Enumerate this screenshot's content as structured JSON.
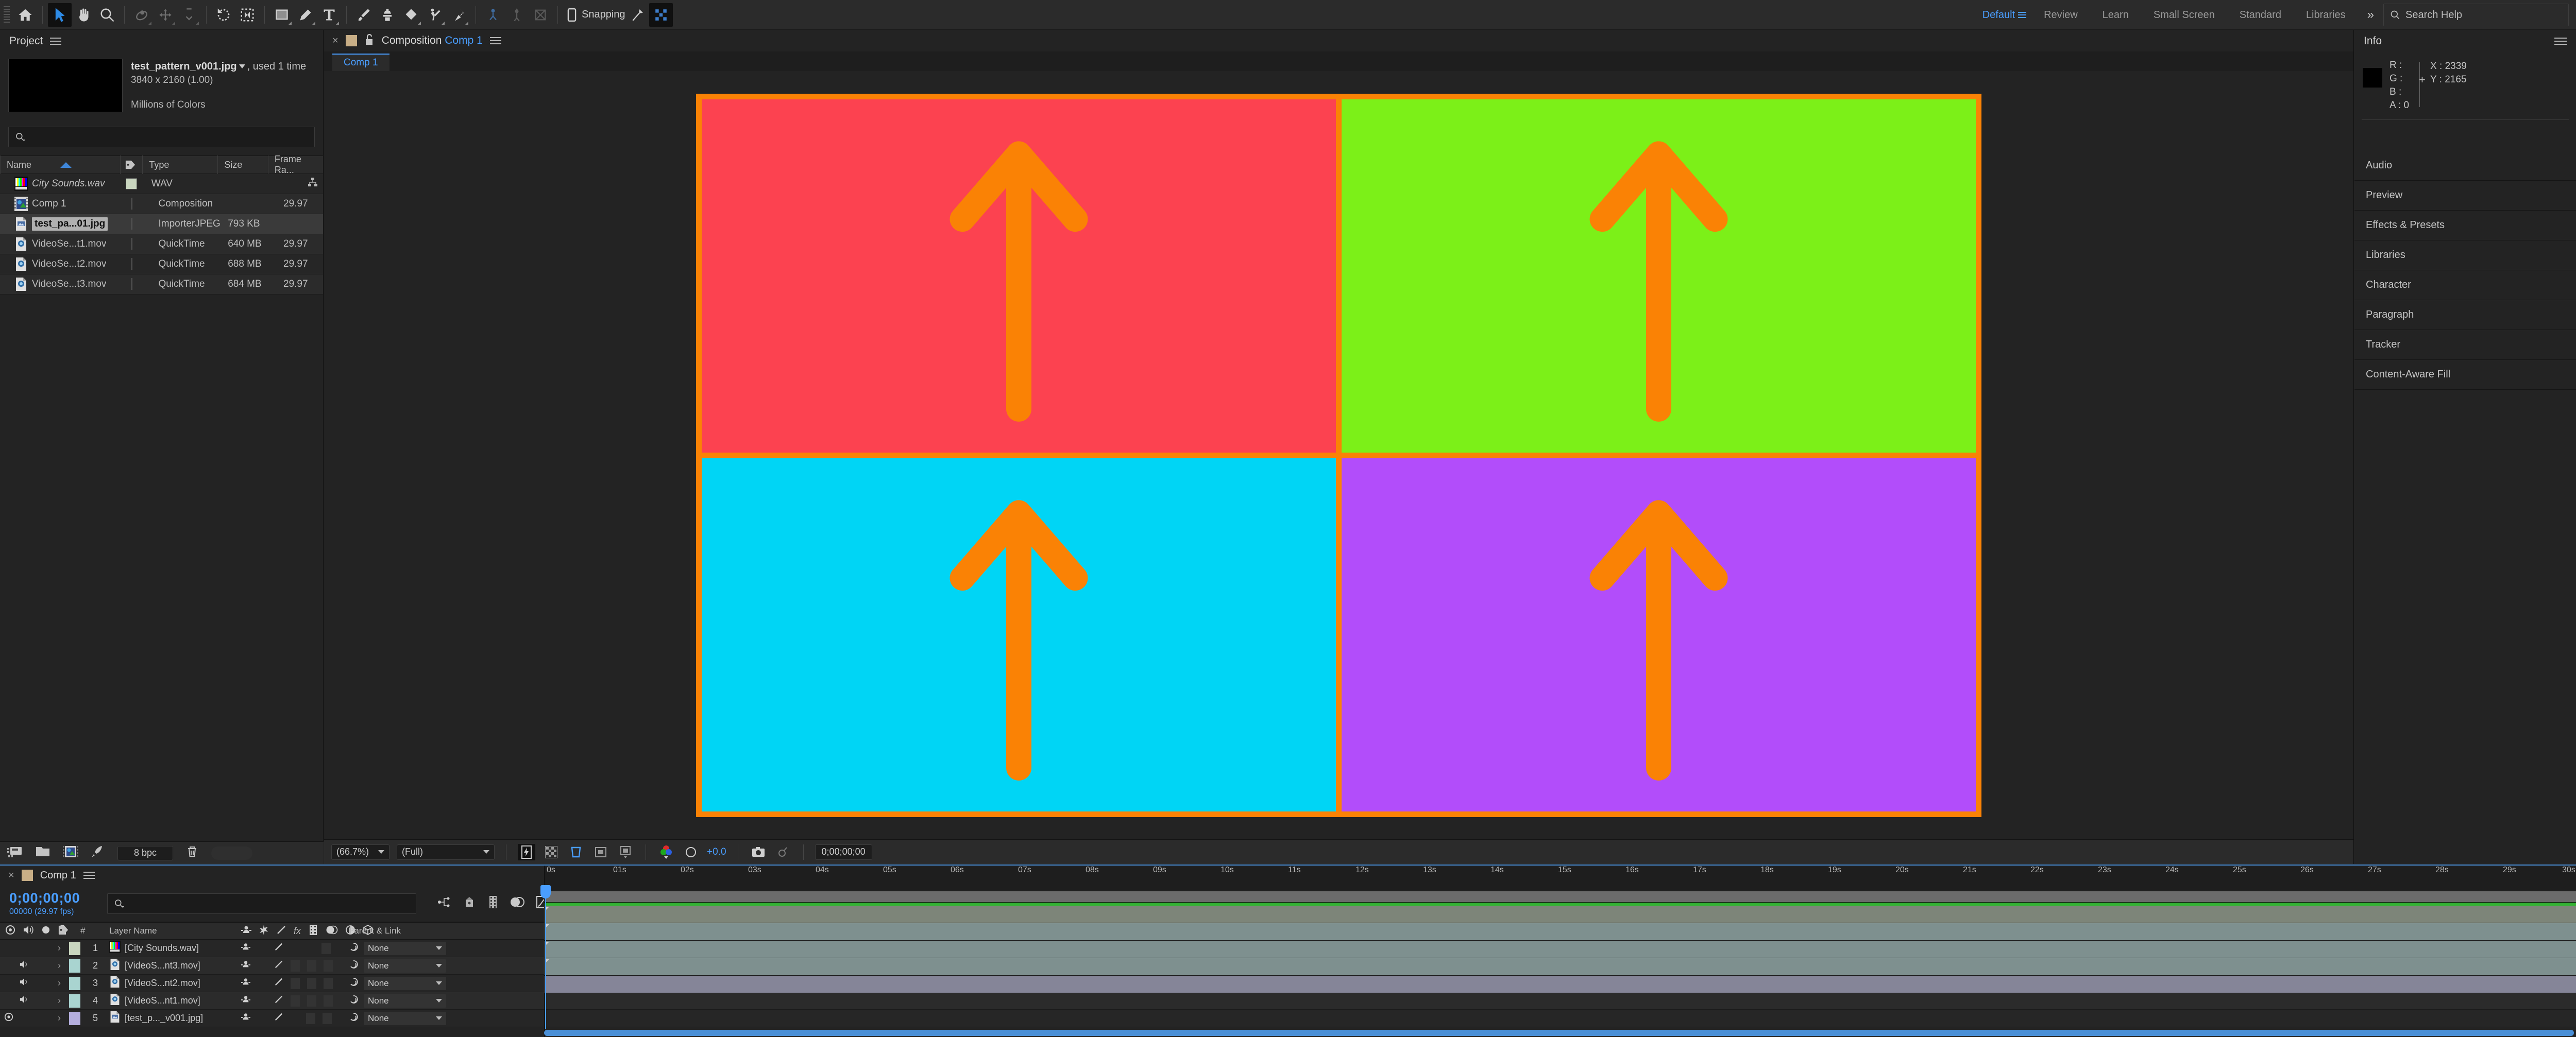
{
  "app": {
    "name": "Adobe After Effects"
  },
  "toolbar": {
    "tools": [
      {
        "name": "home-icon",
        "label": "Home"
      },
      {
        "name": "selection-tool-icon",
        "label": "Selection Tool"
      },
      {
        "name": "hand-tool-icon",
        "label": "Hand Tool"
      },
      {
        "name": "zoom-tool-icon",
        "label": "Zoom Tool"
      },
      {
        "name": "orbit-tool-icon",
        "label": "Orbit Around Cursor Tool"
      },
      {
        "name": "pan-tool-icon",
        "label": "Pan Under Cursor Tool"
      },
      {
        "name": "dolly-tool-icon",
        "label": "Dolly Towards Cursor Tool"
      },
      {
        "name": "rotation-tool-icon",
        "label": "Rotation Tool"
      },
      {
        "name": "anchor-point-tool-icon",
        "label": "Pan Behind (Anchor Point) Tool"
      },
      {
        "name": "rectangle-tool-icon",
        "label": "Rectangle Tool"
      },
      {
        "name": "pen-tool-icon",
        "label": "Pen Tool"
      },
      {
        "name": "type-tool-icon",
        "label": "Horizontal Type Tool"
      },
      {
        "name": "brush-tool-icon",
        "label": "Brush Tool"
      },
      {
        "name": "clone-stamp-tool-icon",
        "label": "Clone Stamp Tool"
      },
      {
        "name": "eraser-tool-icon",
        "label": "Eraser Tool"
      },
      {
        "name": "roto-brush-tool-icon",
        "label": "Roto Brush Tool"
      },
      {
        "name": "puppet-pin-tool-icon",
        "label": "Puppet Position Pin Tool"
      },
      {
        "name": "rigging-tool-icon",
        "label": "Rigging"
      },
      {
        "name": "puppet-starch-tool-icon",
        "label": "Puppet Starch Pin Tool"
      },
      {
        "name": "mesh-tool-icon",
        "label": "Puppet Mesh"
      }
    ],
    "snapping_label": "Snapping"
  },
  "workspaces": {
    "items": [
      "Default",
      "Review",
      "Learn",
      "Small Screen",
      "Standard",
      "Libraries"
    ],
    "selected": "Default",
    "overflow": "»",
    "search_placeholder": "Search Help"
  },
  "project_panel": {
    "title": "Project",
    "preview": {
      "filename": "test_pattern_v001.jpg",
      "usage": ", used 1 time",
      "dimensions": "3840 x 2160 (1.00)",
      "color_depth": "Millions of Colors"
    },
    "search_placeholder": "",
    "columns": [
      "Name",
      "Type",
      "Size",
      "Frame Ra..."
    ],
    "sort_column": "Name",
    "items": [
      {
        "name": "City Sounds.wav",
        "type": "WAV",
        "size": "",
        "frame_rate": "",
        "swatch": "#c9d6bf",
        "icon": "colorbars-icon",
        "selected": false,
        "italic": true
      },
      {
        "name": "Comp 1",
        "type": "Composition",
        "size": "",
        "frame_rate": "29.97",
        "swatch": "#c8ae86",
        "icon": "composition-icon",
        "selected": false,
        "italic": false
      },
      {
        "name": "test_pa...01.jpg",
        "type": "ImporterJPEG",
        "size": "793 KB",
        "frame_rate": "",
        "swatch": "#b4aedd",
        "icon": "jpeg-file-icon",
        "selected": true,
        "italic": false
      },
      {
        "name": "VideoSe...t1.mov",
        "type": "QuickTime",
        "size": "640 MB",
        "frame_rate": "29.97",
        "swatch": "#a9d4d0",
        "icon": "quicktime-file-icon",
        "selected": false,
        "italic": false
      },
      {
        "name": "VideoSe...t2.mov",
        "type": "QuickTime",
        "size": "688 MB",
        "frame_rate": "29.97",
        "swatch": "#a9d4d0",
        "icon": "quicktime-file-icon",
        "selected": false,
        "italic": false
      },
      {
        "name": "VideoSe...t3.mov",
        "type": "QuickTime",
        "size": "684 MB",
        "frame_rate": "29.97",
        "swatch": "#a9d4d0",
        "icon": "quicktime-file-icon",
        "selected": false,
        "italic": false
      }
    ],
    "footer": {
      "bit_depth": "8 bpc",
      "buttons": [
        "interpret-footage-icon",
        "new-folder-icon",
        "new-composition-icon",
        "project-settings-icon",
        "delete-icon"
      ]
    }
  },
  "composition_panel": {
    "label": "Composition",
    "comp_name": "Comp 1",
    "tab_label": "Comp 1",
    "footer": {
      "magnification": "(66.7%)",
      "resolution": "(Full)",
      "exposure": "+0.0",
      "timecode": "0;00;00;00",
      "toggles": [
        "fast-previews-icon",
        "transparency-grid-icon",
        "region-of-interest-icon",
        "mask-shape-icon",
        "guides-icon",
        "channel-icon",
        "exposure-icon",
        "snapshot-icon",
        "show-snapshot-icon"
      ]
    },
    "viewer": {
      "artwork": "test-pattern-four-quadrant-arrows",
      "border_color": "#fa8205",
      "arrow_color": "#fa8205",
      "quadrants": [
        {
          "position": "top-left",
          "color": "#fc4250",
          "arrow": "up"
        },
        {
          "position": "top-right",
          "color": "#7cf018",
          "arrow": "up"
        },
        {
          "position": "bottom-left",
          "color": "#00d5f5",
          "arrow": "up"
        },
        {
          "position": "bottom-right",
          "color": "#b24dfa",
          "arrow": "up"
        }
      ]
    }
  },
  "info_panel": {
    "title": "Info",
    "channels": [
      {
        "label": "R :",
        "value": ""
      },
      {
        "label": "G :",
        "value": ""
      },
      {
        "label": "B :",
        "value": ""
      },
      {
        "label": "A :",
        "value": "0"
      }
    ],
    "coords": [
      {
        "label": "X :",
        "value": "2339"
      },
      {
        "label": "Y :",
        "value": "2165"
      }
    ],
    "sample_color": "#000000"
  },
  "side_panels": [
    "Audio",
    "Preview",
    "Effects & Presets",
    "Libraries",
    "Character",
    "Paragraph",
    "Tracker",
    "Content-Aware Fill"
  ],
  "timeline": {
    "tab_label": "Comp 1",
    "current_time": "0;00;00;00",
    "frame_info": "00000 (29.97 fps)",
    "search_placeholder": "",
    "columns": [
      "#",
      "Layer Name",
      "Parent & Link"
    ],
    "layers": [
      {
        "num": "1",
        "name": "[City Sounds.wav]",
        "parent": "None",
        "swatch": "#c9d6bf",
        "icon": "colorbars-icon",
        "video_on": false,
        "audio_on": false,
        "bar_color": "#7d8579"
      },
      {
        "num": "2",
        "name": "[VideoS...nt3.mov]",
        "parent": "None",
        "swatch": "#a9d4d0",
        "icon": "quicktime-file-icon",
        "video_on": false,
        "audio_on": true,
        "bar_color": "#7e908f"
      },
      {
        "num": "3",
        "name": "[VideoS...nt2.mov]",
        "parent": "None",
        "swatch": "#a9d4d0",
        "icon": "quicktime-file-icon",
        "video_on": false,
        "audio_on": true,
        "bar_color": "#7e908f"
      },
      {
        "num": "4",
        "name": "[VideoS...nt1.mov]",
        "parent": "None",
        "swatch": "#a9d4d0",
        "icon": "quicktime-file-icon",
        "video_on": false,
        "audio_on": true,
        "bar_color": "#7e908f"
      },
      {
        "num": "5",
        "name": "[test_p..._v001.jpg]",
        "parent": "None",
        "swatch": "#b4aedd",
        "icon": "jpeg-file-icon",
        "video_on": true,
        "audio_on": false,
        "bar_color": "#858598"
      }
    ],
    "ruler_ticks": [
      "0s",
      "01s",
      "02s",
      "03s",
      "04s",
      "05s",
      "06s",
      "07s",
      "08s",
      "09s",
      "10s",
      "11s",
      "12s",
      "13s",
      "14s",
      "15s",
      "16s",
      "17s",
      "18s",
      "19s",
      "20s",
      "21s",
      "22s",
      "23s",
      "24s",
      "25s",
      "26s",
      "27s",
      "28s",
      "29s",
      "30s"
    ],
    "playhead_position_s": 0
  },
  "colors": {
    "accent": "#4a9eff",
    "panel_bg": "#232323",
    "toolbar_bg": "#2b2b2b",
    "border": "#101010"
  }
}
